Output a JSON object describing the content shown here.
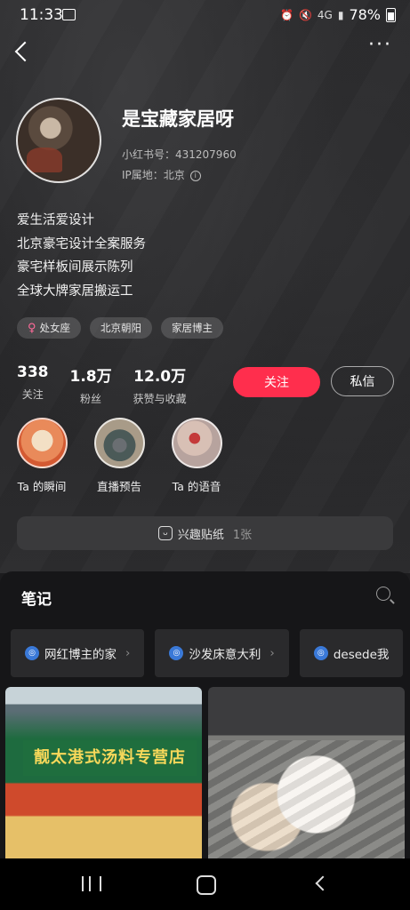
{
  "status_bar": {
    "time": "11:33",
    "network": "4G",
    "battery": "78%"
  },
  "profile": {
    "username": "是宝藏家居呀",
    "user_id": "小红书号：431207960",
    "ip": "IP属地：北京",
    "bio": [
      "爱生活爱设计",
      "北京豪宅设计全案服务",
      "豪宅样板间展示陈列",
      "全球大牌家居搬运工"
    ],
    "tags": [
      {
        "label": "处女座",
        "icon": "female-icon"
      },
      {
        "label": "北京朝阳"
      },
      {
        "label": "家居博主"
      }
    ],
    "stats": [
      {
        "value": "338",
        "label": "关注"
      },
      {
        "value": "1.8万",
        "label": "粉丝"
      },
      {
        "value": "12.0万",
        "label": "获赞与收藏"
      }
    ],
    "follow_label": "关注",
    "message_label": "私信"
  },
  "highlights": [
    {
      "label": "Ta 的瞬间"
    },
    {
      "label": "直播预告"
    },
    {
      "label": "Ta 的语音"
    }
  ],
  "sticker_bar": {
    "label": "兴趣贴纸",
    "count": "1张"
  },
  "notes": {
    "title": "笔记",
    "collections": [
      "网红博主的家",
      "沙发床意大利",
      "desede我"
    ],
    "cards": [
      {
        "image": "storefront-photo",
        "sign_text": "靓太港式汤料专营店"
      },
      {
        "image": "cat-photo"
      }
    ]
  },
  "colors": {
    "accent": "#ff2e4d",
    "background": "#1c1c1e",
    "collection_icon": "#3a79d8"
  }
}
